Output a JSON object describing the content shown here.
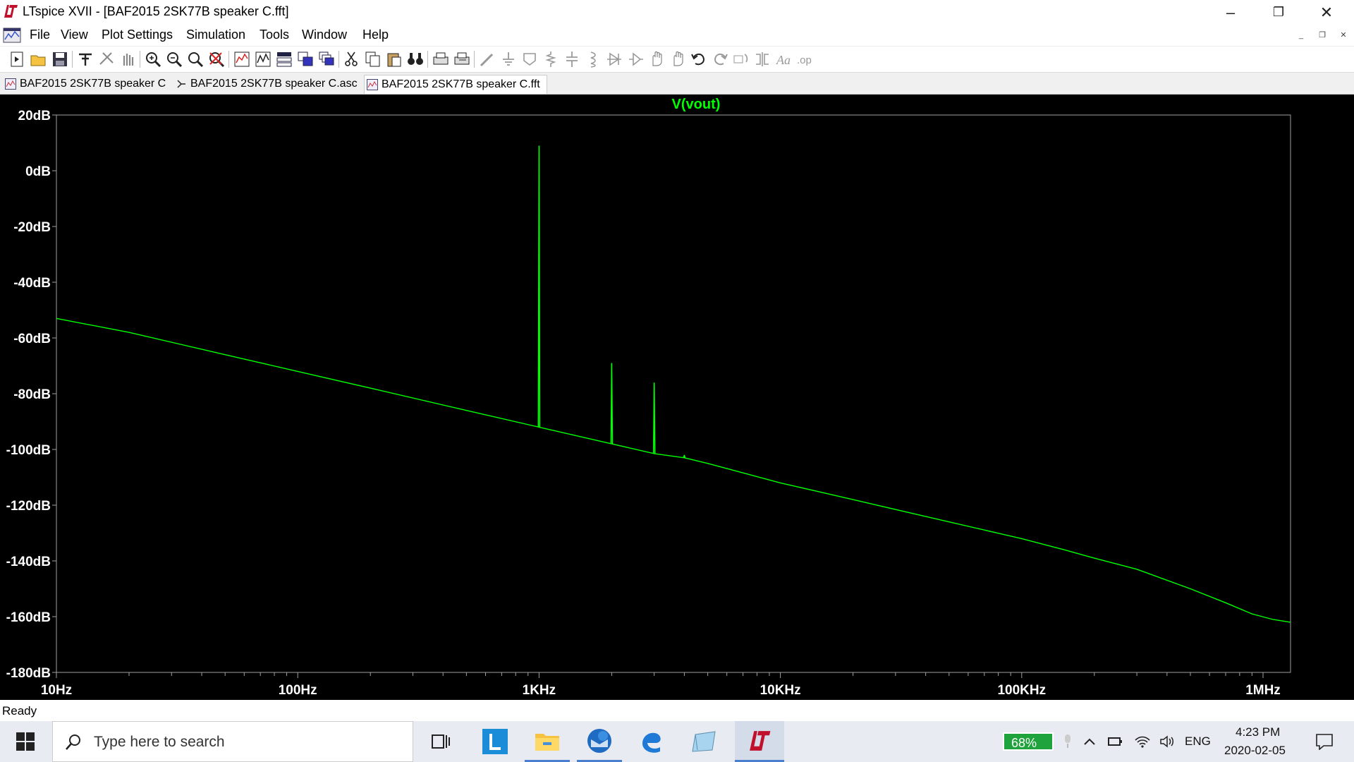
{
  "window": {
    "title": "LTspice XVII - [BAF2015 2SK77B speaker C.fft]",
    "minimize_glyph": "–",
    "restore_glyph": "❐",
    "close_glyph": "✕"
  },
  "menu": {
    "items": [
      "File",
      "View",
      "Plot Settings",
      "Simulation",
      "Tools",
      "Window",
      "Help"
    ],
    "mdi_minimize": "_",
    "mdi_restore": "❐",
    "mdi_close": "✕"
  },
  "toolbar": {
    "icons": [
      "new-schematic-icon",
      "open-icon",
      "save-icon",
      "control-panel-icon",
      "run-icon",
      "halt-icon",
      "zoom-in-icon",
      "zoom-out-icon",
      "zoom-fit-icon",
      "zoom-cancel-icon",
      "autorange-icon",
      "manual-limits-icon",
      "tile-horizontal-icon",
      "tile-vertical-icon",
      "cascade-icon",
      "cut-icon",
      "copy-icon",
      "paste-icon",
      "find-icon",
      "print-icon",
      "print-preview-icon",
      "wire-icon",
      "ground-icon",
      "label-icon",
      "resistor-icon",
      "capacitor-icon",
      "inductor-icon",
      "diode-icon",
      "component-icon",
      "move-icon",
      "drag-icon",
      "undo-icon",
      "redo-icon",
      "rotate-icon",
      "mirror-icon",
      "text-icon",
      "spice-directive-icon"
    ]
  },
  "tabs": [
    {
      "label": "BAF2015 2SK77B speaker C",
      "icon": "waveform-icon",
      "active": false
    },
    {
      "label": "BAF2015 2SK77B speaker C.asc",
      "icon": "schematic-icon",
      "active": false
    },
    {
      "label": "BAF2015 2SK77B speaker C.fft",
      "icon": "waveform-icon",
      "active": true
    }
  ],
  "chart_data": {
    "type": "line",
    "title": "V(vout)",
    "x_scale": "log",
    "xlim": [
      10,
      1300000
    ],
    "ylim": [
      -180,
      20
    ],
    "x_ticks": [
      10,
      100,
      1000,
      10000,
      100000,
      1000000
    ],
    "x_tick_labels": [
      "10Hz",
      "100Hz",
      "1KHz",
      "10KHz",
      "100KHz",
      "1MHz"
    ],
    "y_ticks": [
      20,
      0,
      -20,
      -40,
      -60,
      -80,
      -100,
      -120,
      -140,
      -160,
      -180
    ],
    "y_tick_labels": [
      "20dB",
      "0dB",
      "-20dB",
      "-40dB",
      "-60dB",
      "-80dB",
      "-100dB",
      "-120dB",
      "-140dB",
      "-160dB",
      "-180dB"
    ],
    "grid": false,
    "trace_color": "#00ff00",
    "axis_color": "#a0a0a0",
    "label_color": "#ffffff",
    "series": [
      {
        "name": "V(vout)",
        "x": [
          10,
          20,
          50,
          100,
          200,
          500,
          1000,
          2000,
          3000,
          4000,
          5000,
          10000,
          20000,
          50000,
          100000,
          150000,
          200000,
          300000,
          500000,
          700000,
          900000,
          1100000,
          1300000
        ],
        "y": [
          -53,
          -58,
          -66,
          -72,
          -78,
          -86,
          -92,
          -98,
          -101.5,
          -103,
          -105,
          -112,
          -118,
          -126,
          -132,
          -136,
          -139,
          -143,
          -150,
          -155,
          -159,
          -161,
          -162
        ]
      }
    ],
    "peaks": [
      {
        "x": 1000,
        "base": -92,
        "top": 9
      },
      {
        "x": 2000,
        "base": -98,
        "top": -69
      },
      {
        "x": 3000,
        "base": -101.5,
        "top": -76
      },
      {
        "x": 4000,
        "base": -103,
        "top": -102
      }
    ]
  },
  "status": {
    "text": "Ready"
  },
  "taskbar": {
    "search_placeholder": "Type here to search",
    "battery": "68%",
    "language": "ENG",
    "time": "4:23 PM",
    "date": "2020-02-05",
    "apps": [
      "task-view-icon",
      "l-app-icon",
      "file-explorer-icon",
      "thunderbird-icon",
      "edge-icon",
      "notepad-icon",
      "ltspice-taskbar-icon"
    ]
  }
}
